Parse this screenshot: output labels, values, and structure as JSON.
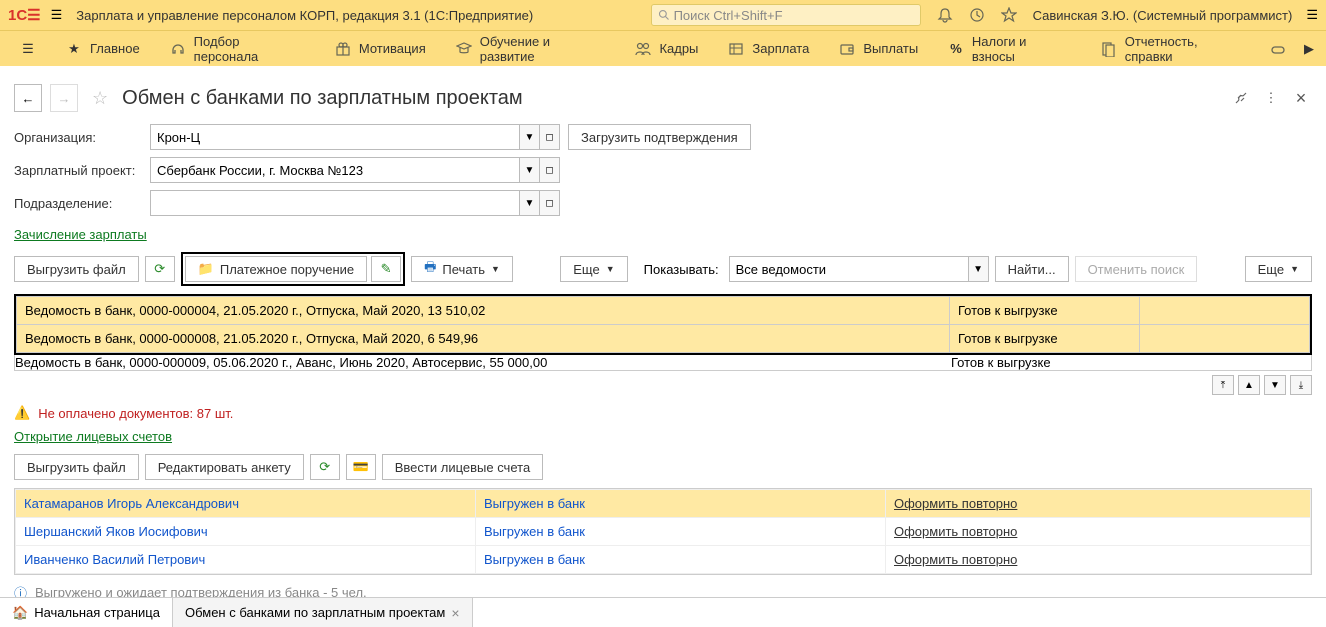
{
  "titlebar": {
    "title": "Зарплата и управление персоналом КОРП, редакция 3.1  (1С:Предприятие)",
    "search_placeholder": "Поиск Ctrl+Shift+F",
    "user": "Савинская З.Ю. (Системный программист)"
  },
  "nav": {
    "items": [
      {
        "label": "Главное"
      },
      {
        "label": "Подбор персонала"
      },
      {
        "label": "Мотивация"
      },
      {
        "label": "Обучение и развитие"
      },
      {
        "label": "Кадры"
      },
      {
        "label": "Зарплата"
      },
      {
        "label": "Выплаты"
      },
      {
        "label": "Налоги и взносы"
      },
      {
        "label": "Отчетность, справки"
      }
    ]
  },
  "header": {
    "title": "Обмен с банками по зарплатным проектам"
  },
  "filters": {
    "org_label": "Организация:",
    "org_value": "Крон-Ц",
    "project_label": "Зарплатный проект:",
    "project_value": "Сбербанк России, г. Москва №123",
    "dept_label": "Подразделение:",
    "dept_value": "",
    "load_btn": "Загрузить подтверждения"
  },
  "section1_link": "Зачисление зарплаты",
  "toolbar1": {
    "export_btn": "Выгрузить файл",
    "payment_btn": "Платежное поручение",
    "print_btn": "Печать",
    "more_btn": "Еще",
    "show_label": "Показывать:",
    "show_value": "Все ведомости",
    "find_btn": "Найти...",
    "cancel_find_btn": "Отменить поиск",
    "more2_btn": "Еще"
  },
  "table1": {
    "rows": [
      {
        "desc": "Ведомость в банк, 0000-000004, 21.05.2020 г., Отпуска, Май 2020, 13 510,02",
        "status": "Готов к выгрузке",
        "sel": true
      },
      {
        "desc": "Ведомость в банк, 0000-000008, 21.05.2020 г., Отпуска, Май 2020, 6 549,96",
        "status": "Готов к выгрузке",
        "sel": true
      },
      {
        "desc": "Ведомость в банк, 0000-000009, 05.06.2020 г., Аванс, Июнь 2020, Автосервис, 55 000,00",
        "status": "Готов к выгрузке",
        "sel": false
      }
    ]
  },
  "warning": {
    "text": "Не оплачено документов: 87 шт."
  },
  "section2_link": "Открытие лицевых счетов",
  "toolbar2": {
    "export_btn": "Выгрузить файл",
    "edit_btn": "Редактировать анкету",
    "enter_btn": "Ввести лицевые счета"
  },
  "table2": {
    "rows": [
      {
        "name": "Катамаранов Игорь Александрович",
        "status": "Выгружен в банк",
        "action": "Оформить повторно",
        "sel": true
      },
      {
        "name": "Шершанский Яков Иосифович",
        "status": "Выгружен в банк",
        "action": "Оформить повторно",
        "sel": false
      },
      {
        "name": "Иванченко Василий Петрович",
        "status": "Выгружен в банк",
        "action": "Оформить повторно",
        "sel": false
      }
    ]
  },
  "info": {
    "text": "Выгружено и ожидает подтверждения из банка - 5 чел."
  },
  "tabs": {
    "home": "Начальная страница",
    "active": "Обмен с банками по зарплатным проектам"
  }
}
